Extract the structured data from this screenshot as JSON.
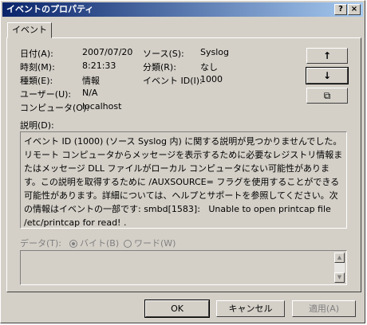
{
  "window": {
    "title": "イベントのプロパティ",
    "help_glyph": "?",
    "close_glyph": "×"
  },
  "tab": {
    "label": "イベント"
  },
  "fields": {
    "date": {
      "label": "日付(A):",
      "value": "2007/07/20"
    },
    "time": {
      "label": "時刻(M):",
      "value": "8:21:33"
    },
    "type": {
      "label": "種類(E):",
      "value": "情報"
    },
    "user": {
      "label": "ユーザー(U):",
      "value": "N/A"
    },
    "computer": {
      "label": "コンピュータ(O):",
      "value": "localhost"
    },
    "source": {
      "label": "ソース(S):",
      "value": "Syslog"
    },
    "category": {
      "label": "分類(R):",
      "value": "なし"
    },
    "event_id": {
      "label": "イベント ID(I):",
      "value": "1000"
    }
  },
  "nav": {
    "up_glyph": "↑",
    "down_glyph": "↓",
    "copy_glyph": "⧉"
  },
  "description": {
    "label": "説明(D):",
    "text": "イベント ID (1000) (ソース Syslog 内) に関する説明が見つかりませんでした。リモート コンピュータからメッセージを表示するために必要なレジストリ情報またはメッセージ DLL ファイルがローカル コンピュータにない可能性があります。この説明を取得するために /AUXSOURCE= フラグを使用することができる可能性があります。詳細については、ヘルプとサポートを参照してください。次の情報はイベントの一部です: smbd[1583]:   Unable to open printcap file /etc/printcap for read! ."
  },
  "data": {
    "label": "データ(T):",
    "bytes_label": "バイト(B)",
    "words_label": "ワード(W)"
  },
  "buttons": {
    "ok": "OK",
    "cancel": "キャンセル",
    "apply": "適用(A)"
  }
}
